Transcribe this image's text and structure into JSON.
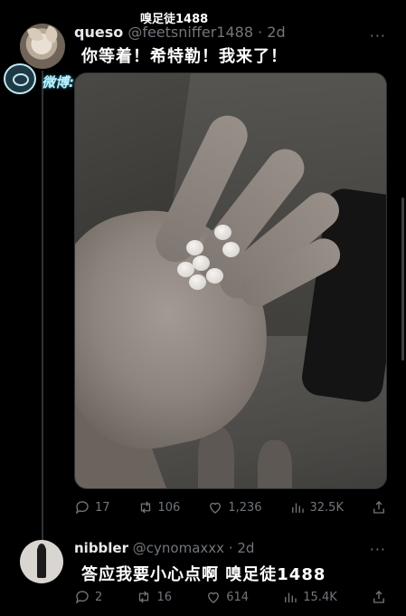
{
  "watermark": {
    "top_text": "嗅足徒1488",
    "weibo_label": "微博:@今日memes"
  },
  "tweet": {
    "name": "queso",
    "handle": "@feetsniffer1488",
    "separator": "·",
    "time": "2d",
    "more": "···",
    "text": "你等着！希特勒！我来了！",
    "media": {
      "kind": "photo",
      "pill_count": 7
    },
    "actions": {
      "replies": "17",
      "retweets": "106",
      "likes": "1,236",
      "views": "32.5K"
    }
  },
  "reply": {
    "name": "nibbler",
    "handle": "@cynomaxxx",
    "separator": "·",
    "time": "2d",
    "more": "···",
    "text": "答应我要小心点啊 嗅足徒1488",
    "actions": {
      "replies": "2",
      "retweets": "16",
      "likes": "614",
      "views": "15.4K"
    }
  }
}
